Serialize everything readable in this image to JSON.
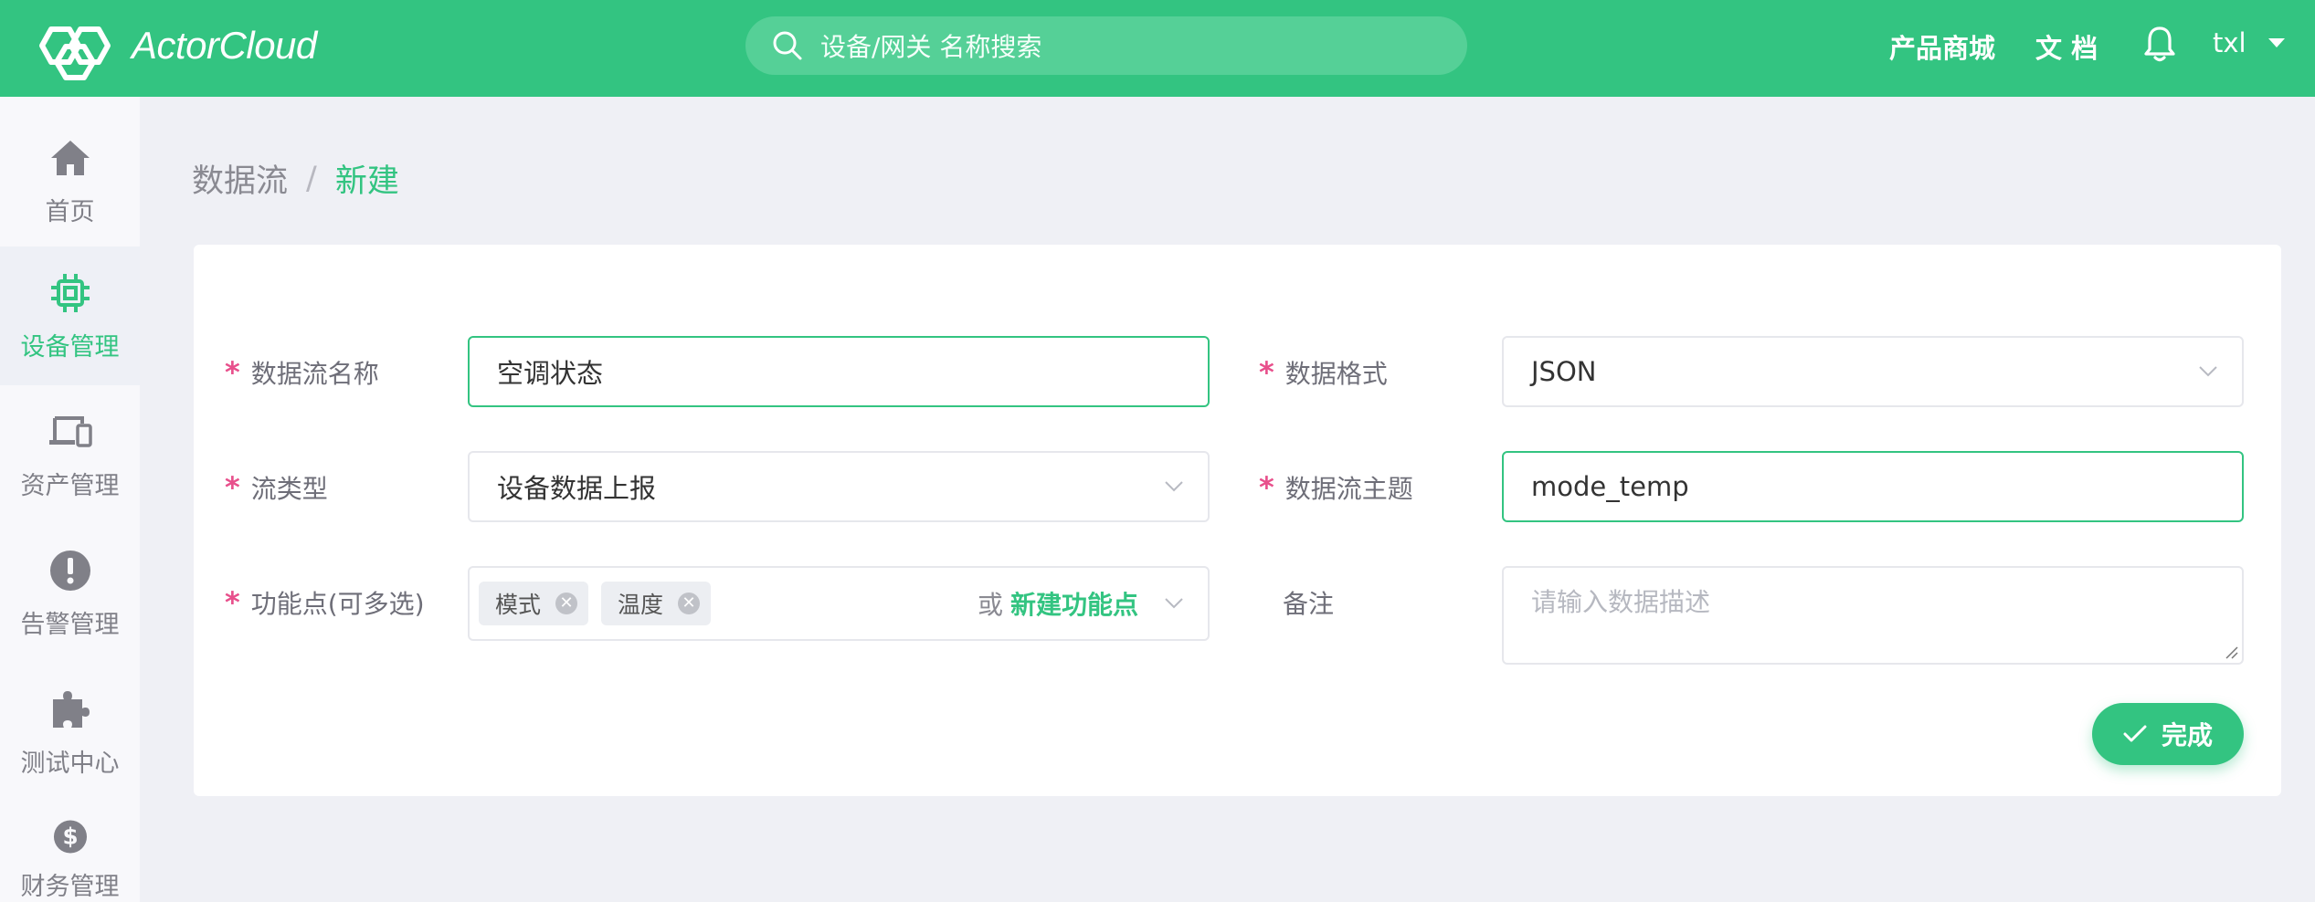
{
  "header": {
    "brand": "ActorCloud",
    "search_placeholder": "设备/网关 名称搜索",
    "links": [
      "产品商城",
      "文 档"
    ],
    "user": "txl",
    "brand_color": "#33c481"
  },
  "sidebar": {
    "items": [
      {
        "label": "首页",
        "icon": "home-icon",
        "active": false
      },
      {
        "label": "设备管理",
        "icon": "chip-icon",
        "active": true
      },
      {
        "label": "资产管理",
        "icon": "devices-icon",
        "active": false
      },
      {
        "label": "告警管理",
        "icon": "alert-icon",
        "active": false
      },
      {
        "label": "测试中心",
        "icon": "puzzle-icon",
        "active": false
      },
      {
        "label": "财务管理",
        "icon": "dollar-icon",
        "active": false
      }
    ]
  },
  "breadcrumb": {
    "parent": "数据流",
    "separator": "/",
    "current": "新建"
  },
  "form": {
    "name": {
      "label": "数据流名称",
      "value": "空调状态"
    },
    "format": {
      "label": "数据格式",
      "value": "JSON"
    },
    "flow_type": {
      "label": "流类型",
      "value": "设备数据上报"
    },
    "topic": {
      "label": "数据流主题",
      "value": "mode_temp"
    },
    "functions": {
      "label": "功能点(可多选)",
      "tags": [
        "模式",
        "温度"
      ],
      "or_text": "或",
      "new_link": "新建功能点"
    },
    "remark": {
      "label": "备注",
      "placeholder": "请输入数据描述"
    },
    "submit_label": "完成"
  }
}
